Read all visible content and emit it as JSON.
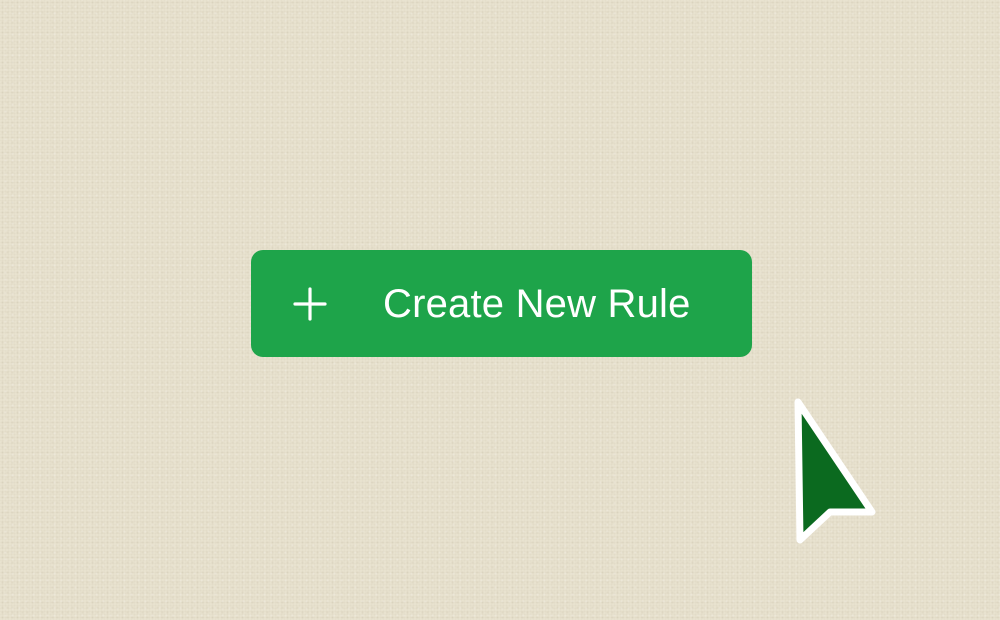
{
  "button": {
    "label": "Create New Rule",
    "icon": "plus-icon",
    "background_color": "#1ea44a",
    "text_color": "#ffffff"
  },
  "cursor": {
    "icon": "pointer-cursor-icon",
    "fill_color": "#0b6a1f",
    "outline_color": "#ffffff"
  },
  "background": {
    "color": "#e8e2cf"
  }
}
